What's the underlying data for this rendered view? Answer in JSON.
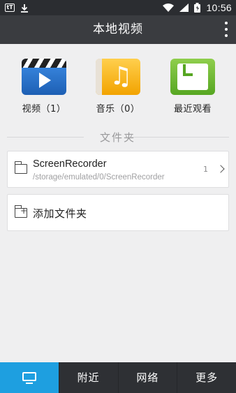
{
  "status_bar": {
    "left_icons": [
      "tt-icon",
      "download-icon"
    ],
    "time": "10:56"
  },
  "header": {
    "title": "本地视频"
  },
  "categories": [
    {
      "label": "视频（1）",
      "icon": "video-clapper-icon"
    },
    {
      "label": "音乐（0）",
      "icon": "music-note-icon"
    },
    {
      "label": "最近观看",
      "icon": "recent-clock-icon"
    }
  ],
  "section": {
    "title": "文件夹"
  },
  "folders": [
    {
      "name": "ScreenRecorder",
      "path": "/storage/emulated/0/ScreenRecorder",
      "count": "1"
    }
  ],
  "add_folder": {
    "label": "添加文件夹"
  },
  "bottom_nav": {
    "items": [
      {
        "label": "",
        "icon": "tv-icon",
        "active": true
      },
      {
        "label": "附近"
      },
      {
        "label": "网络"
      },
      {
        "label": "更多"
      }
    ]
  },
  "colors": {
    "accent": "#1e9fe0",
    "title_bar": "#3a3c40",
    "background": "#efeff0"
  }
}
